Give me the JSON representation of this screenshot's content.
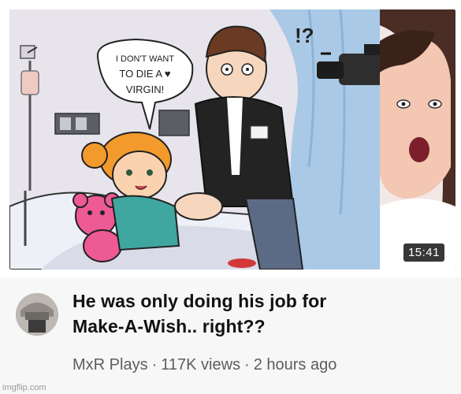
{
  "video": {
    "duration": "15:41",
    "comic_speech": [
      "I DON'T WANT",
      "TO DIE A ♥",
      "VIRGIN!"
    ],
    "comic_exclaim": "!?"
  },
  "meta": {
    "title_line1": "He was only doing his job for",
    "title_line2": "Make-A-Wish.. right??",
    "channel": "MxR Plays",
    "views": "117K views",
    "age": "2 hours ago",
    "separator": "·"
  },
  "watermark": "imgflip.com"
}
